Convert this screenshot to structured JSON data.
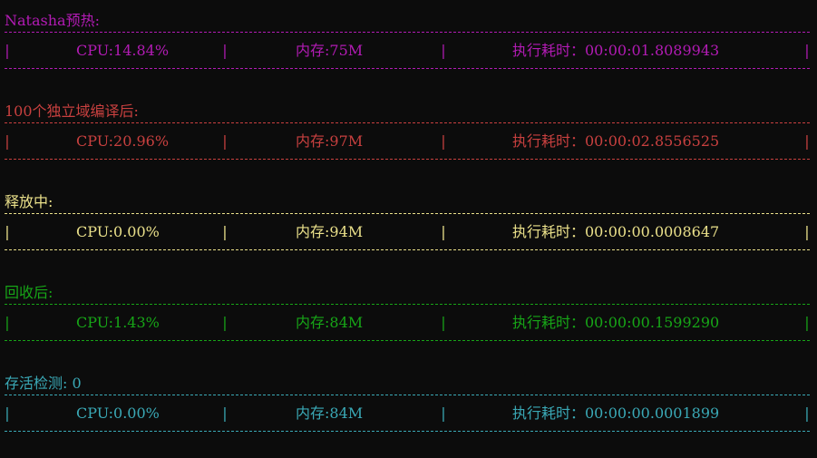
{
  "sections": [
    {
      "heading": "Natasha预热:",
      "cpu": "CPU:14.84%",
      "memory": "内存:75M",
      "duration": "执行耗时：00:00:01.8089943",
      "color": "#b21bb4"
    },
    {
      "heading": "100个独立域编译后:",
      "cpu": "CPU:20.96%",
      "memory": "内存:97M",
      "duration": "执行耗时：00:00:02.8556525",
      "color": "#c8403f"
    },
    {
      "heading": "释放中:",
      "cpu": "CPU:0.00%",
      "memory": "内存:94M",
      "duration": "执行耗时：00:00:00.0008647",
      "color": "#eae08a"
    },
    {
      "heading": "回收后:",
      "cpu": "CPU:1.43%",
      "memory": "内存:84M",
      "duration": "执行耗时：00:00:00.1599290",
      "color": "#17a517"
    },
    {
      "heading": "存活检测: 0",
      "cpu": "CPU:0.00%",
      "memory": "内存:84M",
      "duration": "执行耗时：00:00:00.0001899",
      "color": "#3aa9b6"
    }
  ],
  "separator": "|"
}
